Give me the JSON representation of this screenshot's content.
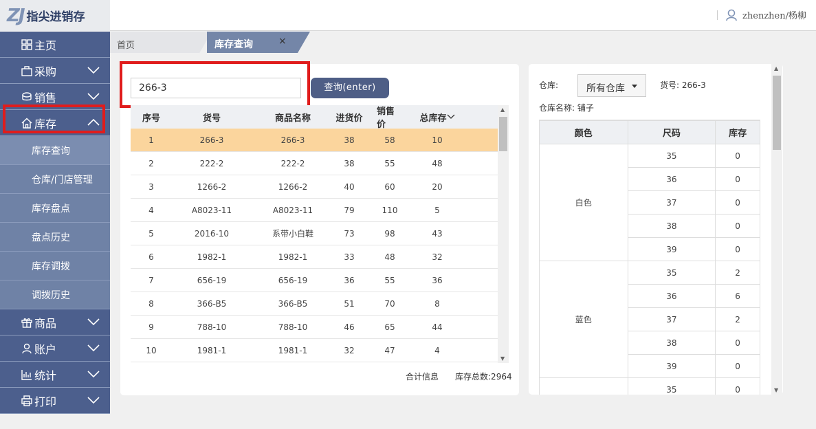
{
  "app": {
    "logo_mark": "ZJ",
    "name": "指尖进销存",
    "user": "zhenzhen/杨柳"
  },
  "sidebar": {
    "items": [
      {
        "label": "主页",
        "icon": "grid-icon"
      },
      {
        "label": "采购",
        "icon": "bag-icon"
      },
      {
        "label": "销售",
        "icon": "coin-icon"
      },
      {
        "label": "库存",
        "icon": "home-icon"
      }
    ],
    "sub_items": [
      "库存查询",
      "仓库/门店管理",
      "库存盘点",
      "盘点历史",
      "库存调拨",
      "调拨历史"
    ],
    "items_after": [
      {
        "label": "商品",
        "icon": "gift-icon"
      },
      {
        "label": "账户",
        "icon": "user-icon"
      },
      {
        "label": "统计",
        "icon": "chart-icon"
      },
      {
        "label": "打印",
        "icon": "printer-icon"
      }
    ]
  },
  "tabs": {
    "home": "首页",
    "active": "库存查询",
    "close": "×"
  },
  "search": {
    "value": "266-3",
    "button": "查询(enter)"
  },
  "stock_table": {
    "headers": [
      "序号",
      "货号",
      "商品名称",
      "进货价",
      "销售价",
      "总库存"
    ],
    "rows": [
      [
        "1",
        "266-3",
        "266-3",
        "38",
        "58",
        "10"
      ],
      [
        "2",
        "222-2",
        "222-2",
        "38",
        "55",
        "48"
      ],
      [
        "3",
        "1266-2",
        "1266-2",
        "40",
        "60",
        "20"
      ],
      [
        "4",
        "A8023-11",
        "A8023-11",
        "79",
        "110",
        "5"
      ],
      [
        "5",
        "2016-10",
        "系带小白鞋",
        "73",
        "98",
        "43"
      ],
      [
        "6",
        "1982-1",
        "1982-1",
        "33",
        "48",
        "32"
      ],
      [
        "7",
        "656-19",
        "656-19",
        "36",
        "55",
        "36"
      ],
      [
        "8",
        "366-B5",
        "366-B5",
        "51",
        "70",
        "8"
      ],
      [
        "9",
        "788-10",
        "788-10",
        "46",
        "65",
        "44"
      ],
      [
        "10",
        "1981-1",
        "1981-1",
        "32",
        "47",
        "4"
      ]
    ],
    "summary_label": "合计信息",
    "summary_total": "库存总数:2964"
  },
  "detail": {
    "warehouse_label": "仓库:",
    "warehouse_value": "所有仓库",
    "item_no": "货号: 266-3",
    "warehouse_name": "仓库名称: 铺子",
    "headers": [
      "颜色",
      "尺码",
      "库存"
    ],
    "groups": [
      {
        "color": "白色",
        "sizes": [
          [
            "35",
            "0"
          ],
          [
            "36",
            "0"
          ],
          [
            "37",
            "0"
          ],
          [
            "38",
            "0"
          ],
          [
            "39",
            "0"
          ]
        ]
      },
      {
        "color": "蓝色",
        "sizes": [
          [
            "35",
            "2"
          ],
          [
            "36",
            "6"
          ],
          [
            "37",
            "2"
          ],
          [
            "38",
            "0"
          ],
          [
            "39",
            "0"
          ]
        ]
      },
      {
        "color": "",
        "sizes": [
          [
            "35",
            "0"
          ]
        ]
      }
    ]
  },
  "colors": {
    "sidebar": "#4c5f8d",
    "submenu": "#6f82a6",
    "selected_row": "#fbd59d",
    "highlight": "#e01c1c",
    "button": "#4e5e86"
  }
}
